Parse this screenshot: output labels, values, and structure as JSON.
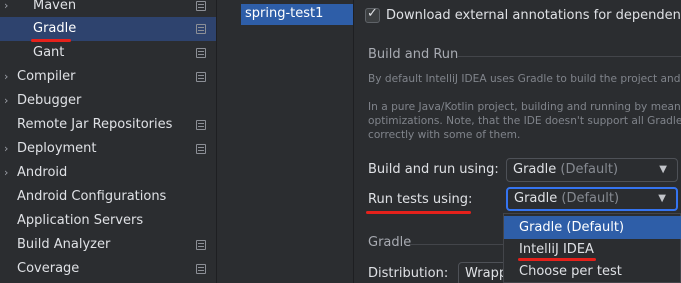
{
  "sidebar": {
    "items": [
      {
        "label": "Maven",
        "expandable": true
      },
      {
        "label": "Gradle",
        "expandable": false,
        "selected": true
      },
      {
        "label": "Gant",
        "expandable": false
      },
      {
        "label": "Compiler",
        "expandable": true
      },
      {
        "label": "Debugger",
        "expandable": true
      },
      {
        "label": "Remote Jar Repositories",
        "expandable": false
      },
      {
        "label": "Deployment",
        "expandable": true
      },
      {
        "label": "Android",
        "expandable": true
      },
      {
        "label": "Android Configurations",
        "expandable": false
      },
      {
        "label": "Application Servers",
        "expandable": false
      },
      {
        "label": "Build Analyzer",
        "expandable": false
      },
      {
        "label": "Coverage",
        "expandable": false
      }
    ],
    "expand_icon": "chevron-right-icon",
    "page_icon": "settings-page-icon"
  },
  "projects": {
    "items": [
      "spring-test1"
    ]
  },
  "panel": {
    "download_annotations_label": "Download external annotations for dependencies",
    "download_annotations_checked": true,
    "build_and_run_title": "Build and Run",
    "desc1_line1": "By default IntelliJ IDEA uses Gradle to build the project and r",
    "desc2_line1": "In a pure Java/Kotlin project, building and running by means c",
    "desc2_line2": "optimizations. Note, that the IDE doesn't support all Gradle",
    "desc2_line3": "correctly with some of them.",
    "build_run_using_label": "Build and run using:",
    "build_run_using_value": "Gradle",
    "build_run_using_hint": "(Default)",
    "run_tests_using_label": "Run tests using:",
    "run_tests_using_value": "Gradle",
    "run_tests_using_hint": "(Default)",
    "run_tests_options": [
      "Gradle (Default)",
      "IntelliJ IDEA",
      "Choose per test"
    ],
    "gradle_title": "Gradle",
    "distribution_label": "Distribution:",
    "distribution_value": "Wrapp"
  },
  "colors": {
    "accent": "#3574f0",
    "selection": "#2e5ea8",
    "annotation": "#e6211b"
  }
}
